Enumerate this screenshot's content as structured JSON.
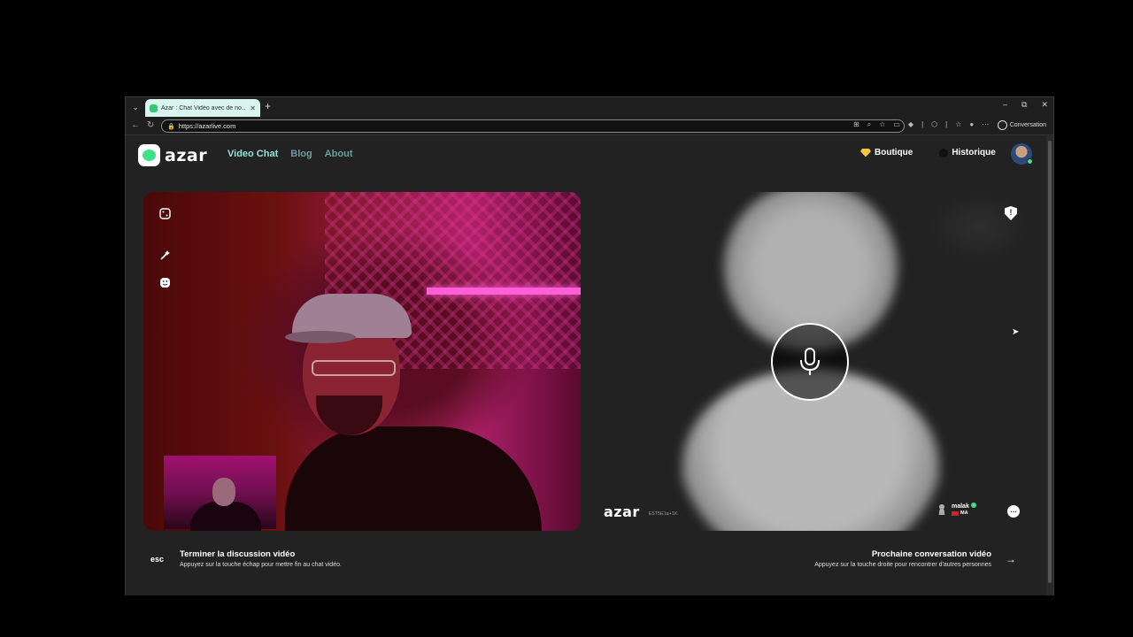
{
  "browser": {
    "tab_title": "Azar : Chat Vidéo avec de no…",
    "url": "https://azarlive.com",
    "profile_label": "Conversation"
  },
  "header": {
    "logo_text": "azar",
    "nav": [
      {
        "label": "Video Chat",
        "active": true
      },
      {
        "label": "Blog"
      },
      {
        "label": "About"
      }
    ],
    "shop_label": "Boutique",
    "history_label": "Historique"
  },
  "remote": {
    "watermark": "azar",
    "session_code": "E5T5E1a+1K",
    "peer_name": "malak",
    "peer_country": "MA"
  },
  "footer": {
    "esc_key": "esc",
    "end_title": "Terminer la discussion vidéo",
    "end_sub": "Appuyez sur la touche échap pour mettre fin au chat vidéo.",
    "next_title": "Prochaine conversation vidéo",
    "next_sub": "Appuyez sur la touche droite pour rencontrer d'autres personnes"
  },
  "colors": {
    "accent": "#8de5d8",
    "brand_green": "#3ee08a",
    "page_bg": "#222222"
  }
}
